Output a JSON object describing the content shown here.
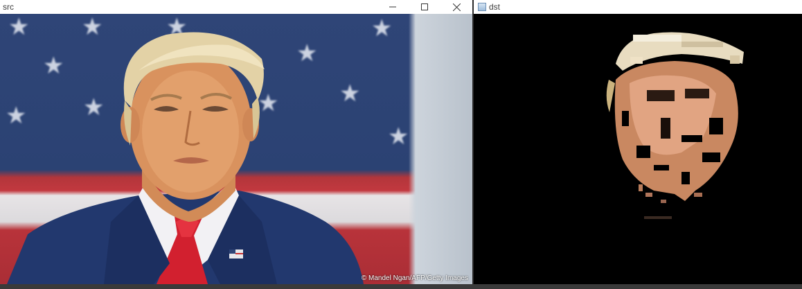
{
  "windows": {
    "src": {
      "title": "src",
      "credit": "© Mandel Ngan/AFP/Getty Images"
    },
    "dst": {
      "title": "dst"
    }
  },
  "icons": {
    "minimize": "minimize-icon",
    "maximize": "maximize-icon",
    "close": "close-icon"
  },
  "colors": {
    "titlebar": "#ffffff",
    "dst_background": "#000000",
    "flag_blue": "#2b4273",
    "flag_red": "#c2383f",
    "suit": "#22386e",
    "tie": "#d2202f",
    "skin": "#d9925e"
  }
}
